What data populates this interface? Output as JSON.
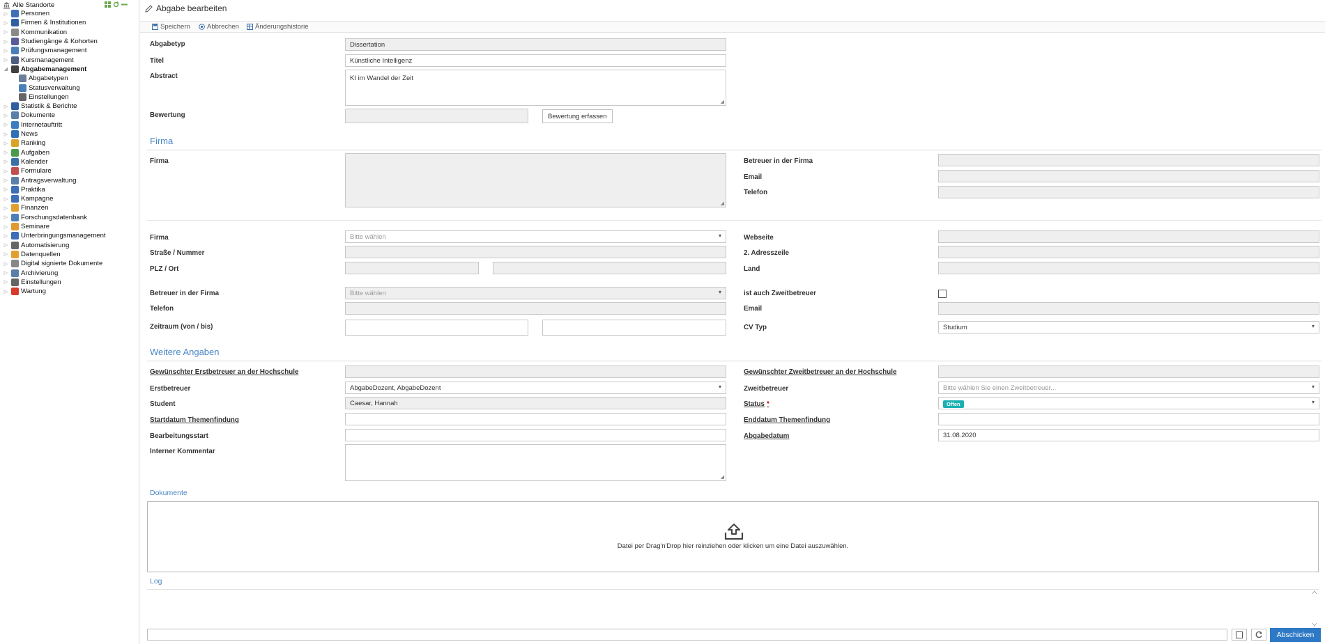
{
  "sidebar": {
    "root_label": "Alle Standorte",
    "items": [
      {
        "label": "Personen",
        "icon": "persons-icon",
        "color": "#3d6fb6"
      },
      {
        "label": "Firmen & Institutionen",
        "icon": "company-icon",
        "color": "#2f5f9e"
      },
      {
        "label": "Kommunikation",
        "icon": "mail-icon",
        "color": "#8a8a8a"
      },
      {
        "label": "Studiengänge & Kohorten",
        "icon": "graduation-icon",
        "color": "#5b5b9a"
      },
      {
        "label": "Prüfungsmanagement",
        "icon": "exam-icon",
        "color": "#4b7fb9"
      },
      {
        "label": "Kursmanagement",
        "icon": "course-icon",
        "color": "#4f5f82"
      },
      {
        "label": "Abgabemanagement",
        "icon": "submission-icon",
        "color": "#404040",
        "bold": true,
        "expanded": true
      },
      {
        "label": "Abgabetypen",
        "icon": "types-icon",
        "color": "#6a7f99",
        "child": true
      },
      {
        "label": "Statusverwaltung",
        "icon": "tag-icon",
        "color": "#4b7fb9",
        "child": true
      },
      {
        "label": "Einstellungen",
        "icon": "gear-icon",
        "color": "#666",
        "child": true
      },
      {
        "label": "Statistik & Berichte",
        "icon": "chart-icon",
        "color": "#2f5f9e"
      },
      {
        "label": "Dokumente",
        "icon": "folder-icon",
        "color": "#5b7fa8"
      },
      {
        "label": "Internetauftritt",
        "icon": "globe-icon",
        "color": "#3b7ec2"
      },
      {
        "label": "News",
        "icon": "info-icon",
        "color": "#2f6fb5"
      },
      {
        "label": "Ranking",
        "icon": "ranking-icon",
        "color": "#d9a32a"
      },
      {
        "label": "Aufgaben",
        "icon": "clock-icon",
        "color": "#4a9a4a"
      },
      {
        "label": "Kalender",
        "icon": "calendar-icon",
        "color": "#3b6fa8"
      },
      {
        "label": "Formulare",
        "icon": "form-icon",
        "color": "#c0504d"
      },
      {
        "label": "Antragsverwaltung",
        "icon": "request-icon",
        "color": "#5b7fa8"
      },
      {
        "label": "Praktika",
        "icon": "internship-icon",
        "color": "#3d6fb6"
      },
      {
        "label": "Kampagne",
        "icon": "campaign-icon",
        "color": "#3d6fb6"
      },
      {
        "label": "Finanzen",
        "icon": "finance-icon",
        "color": "#e0a030"
      },
      {
        "label": "Forschungsdatenbank",
        "icon": "research-icon",
        "color": "#4b7fb9"
      },
      {
        "label": "Seminare",
        "icon": "seminar-icon",
        "color": "#e09a30"
      },
      {
        "label": "Unterbringungsmanagement",
        "icon": "housing-icon",
        "color": "#3d6fb6"
      },
      {
        "label": "Automatisierung",
        "icon": "gear-icon",
        "color": "#666"
      },
      {
        "label": "Datenquellen",
        "icon": "datasource-icon",
        "color": "#e0a030"
      },
      {
        "label": "Digital signierte Dokumente",
        "icon": "signed-doc-icon",
        "color": "#888"
      },
      {
        "label": "Archivierung",
        "icon": "archive-icon",
        "color": "#5b7fa8"
      },
      {
        "label": "Einstellungen",
        "icon": "gear-icon",
        "color": "#666"
      },
      {
        "label": "Wartung",
        "icon": "maintenance-icon",
        "color": "#d93a2a"
      }
    ]
  },
  "page": {
    "title": "Abgabe bearbeiten",
    "toolbar": {
      "save": "Speichern",
      "cancel": "Abbrechen",
      "history": "Änderungshistorie"
    }
  },
  "form": {
    "abgabetyp": {
      "label": "Abgabetyp",
      "value": "Dissertation"
    },
    "titel": {
      "label": "Titel",
      "value": "Künstliche Intelligenz"
    },
    "abstract": {
      "label": "Abstract",
      "value": "KI im Wandel der Zeit"
    },
    "bewertung": {
      "label": "Bewertung",
      "value": "",
      "button": "Bewertung erfassen"
    }
  },
  "firma_section": {
    "title": "Firma",
    "firma_text": {
      "label": "Firma",
      "value": ""
    },
    "betreuer_firma": {
      "label": "Betreuer in der Firma",
      "value": ""
    },
    "email": {
      "label": "Email",
      "value": ""
    },
    "telefon": {
      "label": "Telefon",
      "value": ""
    },
    "firma_select": {
      "label": "Firma",
      "placeholder": "Bitte wählen"
    },
    "webseite": {
      "label": "Webseite",
      "value": ""
    },
    "strasse": {
      "label": "Straße / Nummer",
      "value": ""
    },
    "adresszeile2": {
      "label": "2. Adresszeile",
      "value": ""
    },
    "plz_ort": {
      "label": "PLZ / Ort",
      "plz": "",
      "ort": ""
    },
    "land": {
      "label": "Land",
      "value": ""
    },
    "betreuer_select": {
      "label": "Betreuer in der Firma",
      "placeholder": "Bitte wählen"
    },
    "zweitbetreuer_check": {
      "label": "ist auch Zweitbetreuer",
      "checked": false
    },
    "telefon2": {
      "label": "Telefon",
      "value": ""
    },
    "email2": {
      "label": "Email",
      "value": ""
    },
    "zeitraum": {
      "label": "Zeitraum (von / bis)",
      "von": "",
      "bis": ""
    },
    "cv_typ": {
      "label": "CV Typ",
      "value": "Studium"
    }
  },
  "weitere_section": {
    "title": "Weitere Angaben",
    "gew_erstbetreuer": {
      "label": "Gewünschter Erstbetreuer an der Hochschule",
      "value": ""
    },
    "gew_zweitbetreuer": {
      "label": "Gewünschter Zweitbetreuer an der Hochschule",
      "value": ""
    },
    "erstbetreuer": {
      "label": "Erstbetreuer",
      "value": "AbgabeDozent, AbgabeDozent"
    },
    "zweitbetreuer": {
      "label": "Zweitbetreuer",
      "placeholder": "Bitte wählen Sie einen Zweitbetreuer..."
    },
    "student": {
      "label": "Student",
      "value": "Caesar, Hannah"
    },
    "status": {
      "label": "Status",
      "required": "*",
      "value": "Offen",
      "color": "#1bb0b3"
    },
    "start_themen": {
      "label": "Startdatum Themenfindung",
      "value": ""
    },
    "end_themen": {
      "label": "Enddatum Themenfindung",
      "value": ""
    },
    "bearbeitungsstart": {
      "label": "Bearbeitungsstart",
      "value": ""
    },
    "abgabedatum": {
      "label": "Abgabedatum",
      "value": "31.08.2020"
    },
    "kommentar": {
      "label": "Interner Kommentar",
      "value": ""
    }
  },
  "documents": {
    "title": "Dokumente",
    "dropzone_text": "Datei per Drag'n'Drop hier reinziehen oder klicken um eine Datei auszuwählen."
  },
  "log": {
    "title": "Log",
    "input_value": "",
    "submit": "Abschicken"
  },
  "colors": {
    "accent": "#4a86c5",
    "primary_button": "#2e79c5",
    "readonly_bg": "#efefef"
  }
}
